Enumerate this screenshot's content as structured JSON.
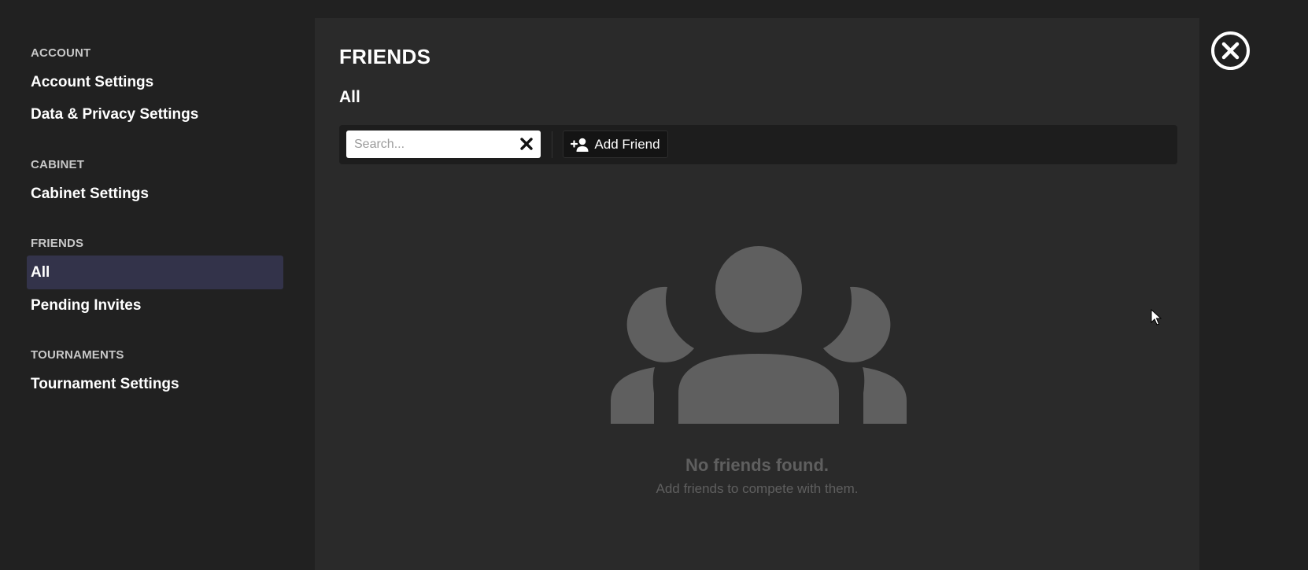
{
  "sidebar": {
    "sections": [
      {
        "title": "ACCOUNT",
        "items": [
          "Account Settings",
          "Data & Privacy Settings"
        ]
      },
      {
        "title": "CABINET",
        "items": [
          "Cabinet Settings"
        ]
      },
      {
        "title": "FRIENDS",
        "items": [
          "All",
          "Pending Invites"
        ]
      },
      {
        "title": "TOURNAMENTS",
        "items": [
          "Tournament Settings"
        ]
      }
    ],
    "active_item": "All"
  },
  "main": {
    "title": "FRIENDS",
    "subtitle": "All",
    "search": {
      "placeholder": "Search...",
      "value": ""
    },
    "add_friend_label": "Add Friend",
    "empty_state": {
      "icon": "users-icon",
      "title": "No friends found.",
      "subtitle": "Add friends to compete with them."
    }
  },
  "colors": {
    "background": "#212121",
    "panel": "#2a2a2a",
    "toolbar": "#1d1d1d",
    "active_item": "#33334a",
    "muted": "#5f5f5f"
  },
  "icons": {
    "close": "close-circle-icon",
    "clear": "x-icon",
    "add_friend": "user-plus-icon",
    "cursor": "mouse-cursor-icon"
  }
}
